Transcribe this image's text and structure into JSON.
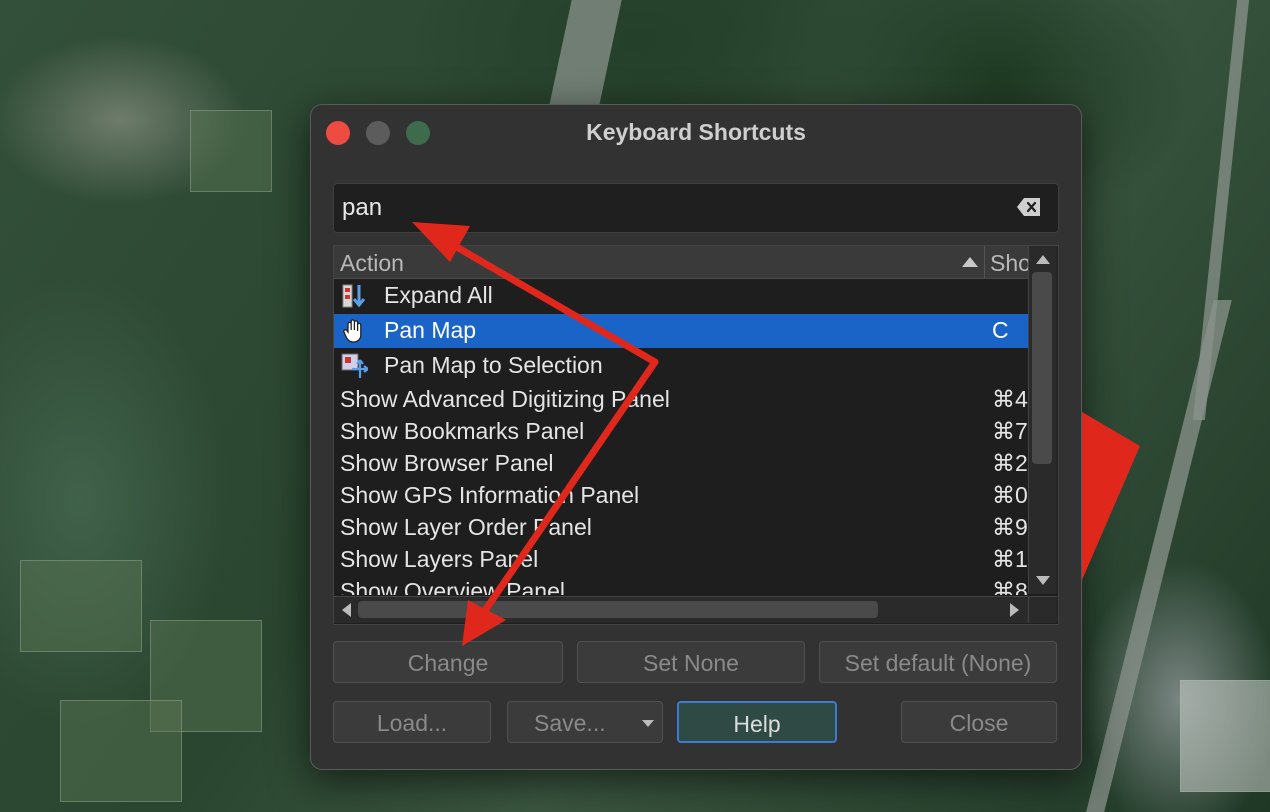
{
  "window": {
    "title": "Keyboard Shortcuts"
  },
  "search": {
    "value": "pan",
    "clear_icon": "clear-backspace-icon"
  },
  "table": {
    "columns": [
      "Action",
      "Sho"
    ],
    "rows": [
      {
        "icon": "expand-all-icon",
        "action": "Expand All",
        "shortcut": ""
      },
      {
        "icon": "pan-hand-icon",
        "action": "Pan Map",
        "shortcut": "C",
        "selected": true
      },
      {
        "icon": "pan-to-selection-icon",
        "action": "Pan Map to Selection",
        "shortcut": ""
      },
      {
        "action": "Show Advanced Digitizing Panel",
        "shortcut": "⌘4"
      },
      {
        "action": "Show Bookmarks Panel",
        "shortcut": "⌘7"
      },
      {
        "action": "Show Browser Panel",
        "shortcut": "⌘2"
      },
      {
        "action": "Show GPS Information Panel",
        "shortcut": "⌘0"
      },
      {
        "action": "Show Layer Order Panel",
        "shortcut": "⌘9"
      },
      {
        "action": "Show Layers Panel",
        "shortcut": "⌘1"
      },
      {
        "action": "Show Overview Panel",
        "shortcut": "⌘8"
      }
    ]
  },
  "buttons": {
    "change": "Change",
    "set_none": "Set None",
    "set_default": "Set default (None)",
    "load": "Load...",
    "save": "Save...",
    "help": "Help",
    "close": "Close"
  },
  "colors": {
    "selection": "#1a64c8",
    "annotation_arrow": "#e0271c",
    "close_dot": "#ee4b42"
  }
}
